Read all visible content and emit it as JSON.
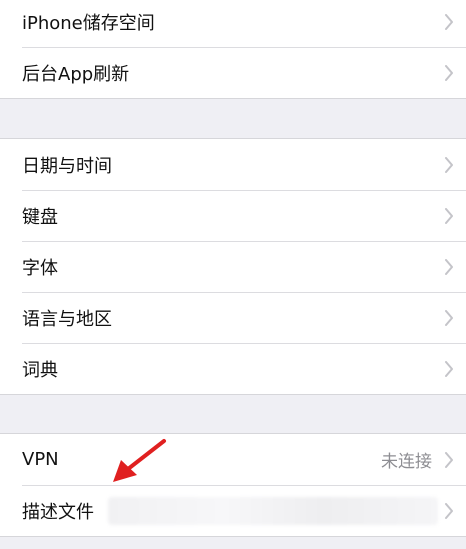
{
  "group1": {
    "items": [
      {
        "label": "iPhone储存空间"
      },
      {
        "label": "后台App刷新"
      }
    ]
  },
  "group2": {
    "items": [
      {
        "label": "日期与时间"
      },
      {
        "label": "键盘"
      },
      {
        "label": "字体"
      },
      {
        "label": "语言与地区"
      },
      {
        "label": "词典"
      }
    ]
  },
  "group3": {
    "items": [
      {
        "label": "VPN",
        "value": "未连接"
      },
      {
        "label": "描述文件"
      }
    ]
  },
  "icons": {
    "chevron": "chevron-right-icon",
    "annotation": "red-arrow-icon"
  },
  "colors": {
    "background": "#efeff4",
    "cell": "#ffffff",
    "chevron": "#c4c4c9",
    "secondary_text": "#8e8e93",
    "annotation": "#e02020"
  }
}
